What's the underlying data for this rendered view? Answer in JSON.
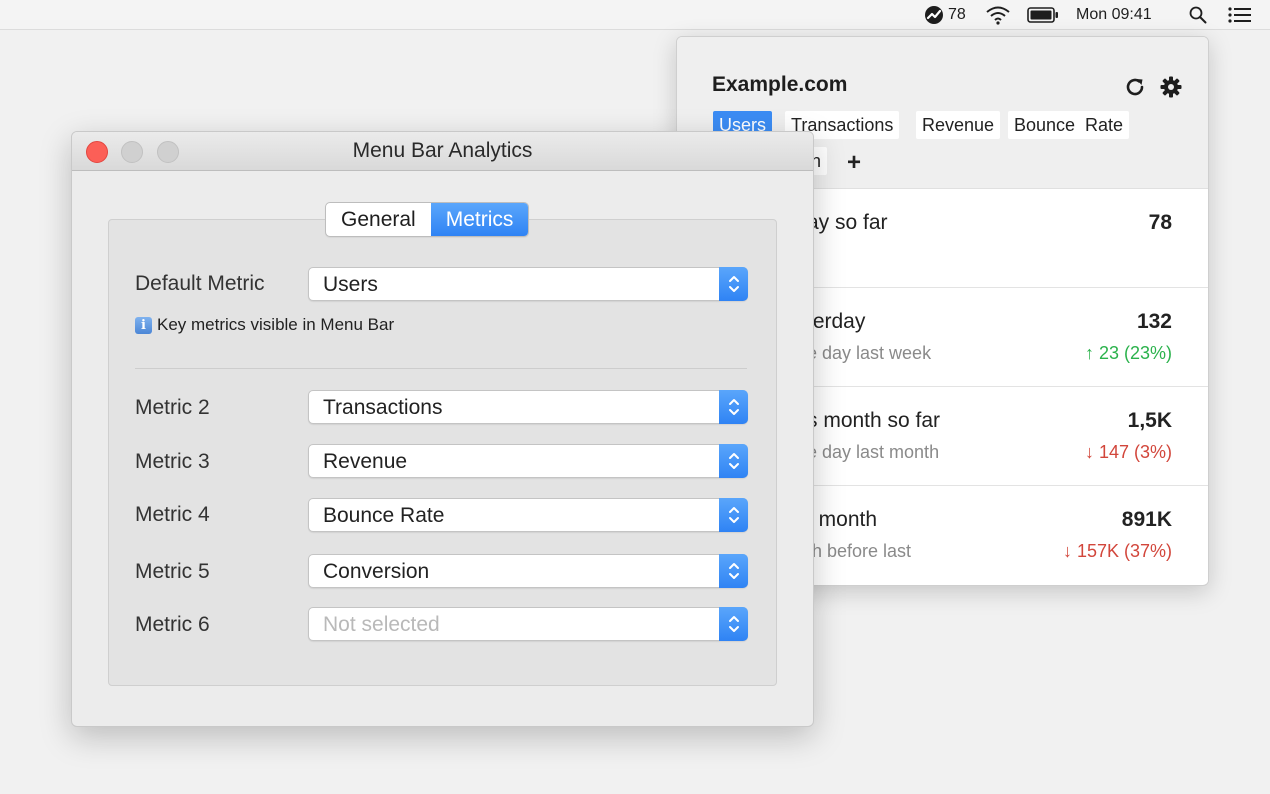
{
  "menubar": {
    "battery_indicator_count": "78",
    "clock": "Mon 09:41"
  },
  "popover": {
    "title": "Example.com",
    "tabs": [
      "Users",
      "Transactions",
      "Revenue",
      "Bounce  Rate"
    ],
    "second_row_tab_fragment": "n",
    "add_label": "+",
    "rows": [
      {
        "title": "ay so far",
        "subtitle": "",
        "value": "78",
        "change": ""
      },
      {
        "title": "terday",
        "subtitle": "e day last week",
        "value": "132",
        "change": "↑ 23 (23%)",
        "direction": "up"
      },
      {
        "title": "s month so far",
        "subtitle": "e day last month",
        "value": "1,5K",
        "change": "↓ 147 (3%)",
        "direction": "down"
      },
      {
        "title": "t month",
        "subtitle": "th before last",
        "value": "891K",
        "change": "↓ 157K (37%)",
        "direction": "down"
      }
    ],
    "colors": {
      "up": "#2bb24c",
      "down": "#d2463b",
      "accent": "#3b8cf4"
    }
  },
  "window": {
    "title": "Menu Bar Analytics",
    "segments": {
      "general": "General",
      "metrics": "Metrics",
      "selected": "Metrics"
    },
    "default_metric": {
      "label": "Default Metric",
      "value": "Users"
    },
    "hint": "Key metrics visible in Menu Bar",
    "metrics": [
      {
        "label": "Metric 2",
        "value": "Transactions",
        "placeholder": false
      },
      {
        "label": "Metric 3",
        "value": "Revenue",
        "placeholder": false
      },
      {
        "label": "Metric 4",
        "value": "Bounce Rate",
        "placeholder": false
      },
      {
        "label": "Metric 5",
        "value": "Conversion",
        "placeholder": false
      },
      {
        "label": "Metric 6",
        "value": "Not selected",
        "placeholder": true
      }
    ]
  }
}
